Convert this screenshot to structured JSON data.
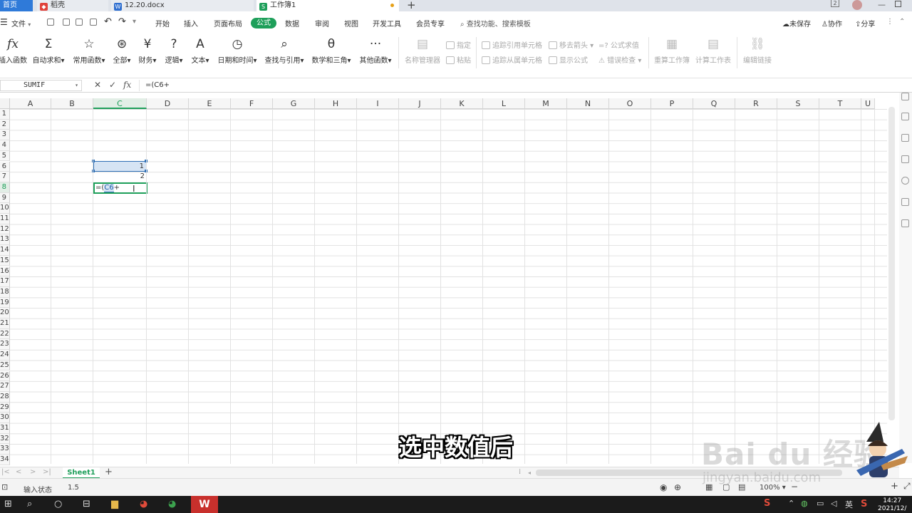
{
  "tabs": {
    "home": "首页",
    "docer": "稻壳",
    "docx": "12.20.docx",
    "sheet": "工作簿1"
  },
  "window": {
    "badge": "2"
  },
  "menu": {
    "file": "文件",
    "items": [
      "开始",
      "插入",
      "页面布局"
    ],
    "formula": "公式",
    "items2": [
      "数据",
      "审阅",
      "视图",
      "开发工具",
      "会员专享"
    ],
    "search": "查找功能、搜索模板",
    "unsaved": "未保存",
    "collab": "协作",
    "share": "分享"
  },
  "ribbon": {
    "insert_fn": "插入函数",
    "autosum": "自动求和",
    "common": "常用函数",
    "all": "全部",
    "finance": "财务",
    "logic": "逻辑",
    "text": "文本",
    "datetime": "日期和时间",
    "lookup": "查找与引用",
    "math": "数学和三角",
    "other": "其他函数",
    "name_mgr": "名称管理器",
    "specify": "指定",
    "paste": "粘贴",
    "trace_prec": "追踪引用单元格",
    "trace_dep": "追踪从属单元格",
    "remove_arrows": "移去箭头",
    "show_formula": "显示公式",
    "eval_formula": "公式求值",
    "error_check": "错误检查",
    "recalc_book": "重算工作簿",
    "calc_sheet": "计算工作表",
    "edit_links": "编辑链接"
  },
  "formula_bar": {
    "name_box": "SUMIF",
    "content": "=(C6+"
  },
  "columns": [
    "A",
    "B",
    "C",
    "D",
    "E",
    "F",
    "G",
    "H",
    "I",
    "J",
    "K",
    "L",
    "M",
    "N",
    "O",
    "P",
    "Q",
    "R",
    "S",
    "T",
    "U"
  ],
  "rows": [
    "1",
    "2",
    "3",
    "4",
    "5",
    "6",
    "7",
    "8",
    "9",
    "10",
    "11",
    "12",
    "13",
    "14",
    "15",
    "16",
    "17",
    "18",
    "19",
    "20",
    "21",
    "22",
    "23",
    "24",
    "25",
    "26",
    "27",
    "28",
    "29",
    "30",
    "31",
    "32",
    "33",
    "34"
  ],
  "cells": {
    "c6": "1",
    "c7": "2",
    "c8_prefix": "=(",
    "c8_ref": "C6",
    "c8_suffix": "+"
  },
  "sheets": {
    "active": "Sheet1"
  },
  "status": {
    "mode": "输入状态",
    "value": "1.5",
    "zoom": "100%"
  },
  "clock": {
    "time": "14:27",
    "date": "2021/12/"
  },
  "subtitle": "选中数值后",
  "watermark": {
    "main": "Bai du 经验",
    "sub": "jingyan.baidu.com"
  }
}
